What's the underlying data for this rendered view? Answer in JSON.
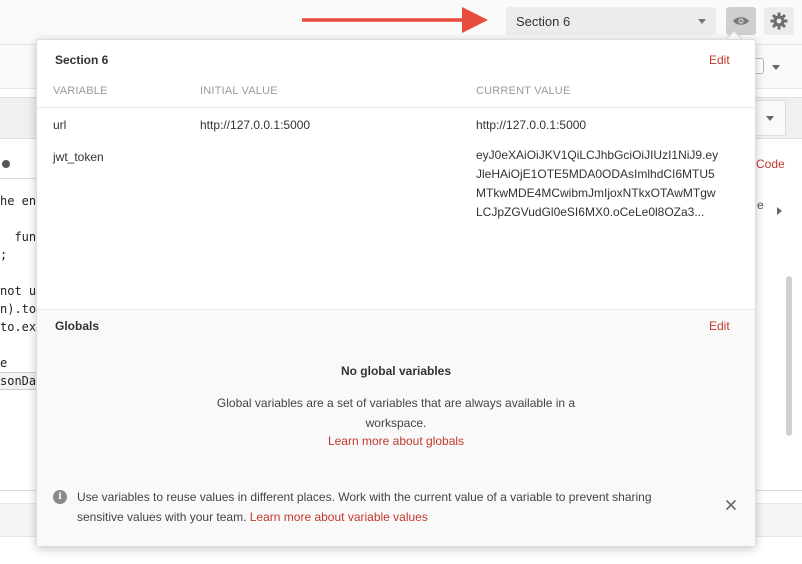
{
  "environment": {
    "selected": "Section 6"
  },
  "popup": {
    "section_title": "Section 6",
    "edit_label": "Edit",
    "columns": [
      "VARIABLE",
      "INITIAL VALUE",
      "CURRENT VALUE"
    ],
    "rows": [
      {
        "variable": "url",
        "initial": "http://127.0.0.1:5000",
        "current": "http://127.0.0.1:5000"
      },
      {
        "variable": "jwt_token",
        "initial": "",
        "current": "eyJ0eXAiOiJKV1QiLCJhbGciOiJIUzI1NiJ9.eyJleHAiOjE1OTE5MDA0ODAsImlhdCI6MTU5MTkwMDE4MCwibmJmIjoxNTkxOTAwMTgwLCJpZGVudGl0eSI6MX0.oCeLe0l8OZa3..."
      }
    ],
    "globals": {
      "title": "Globals",
      "edit_label": "Edit",
      "empty_title": "No global variables",
      "empty_description": "Global variables are a set of variables that are always available in a workspace.",
      "learn_more": "Learn more about globals"
    },
    "info": {
      "text": "Use variables to reuse values in different places. Work with the current value of a variable to prevent sharing sensitive values with your team.",
      "link": "Learn more about variable values"
    }
  },
  "background": {
    "code_link": "Code",
    "side_letter": "e",
    "code_lines": [
      "he en",
      "",
      "  func",
      ";",
      "",
      "not u",
      "n).to",
      "to.ex",
      "",
      "e",
      "sonDa"
    ]
  },
  "colors": {
    "accent": "#c0392b",
    "annotation_arrow": "#e74c3c"
  }
}
